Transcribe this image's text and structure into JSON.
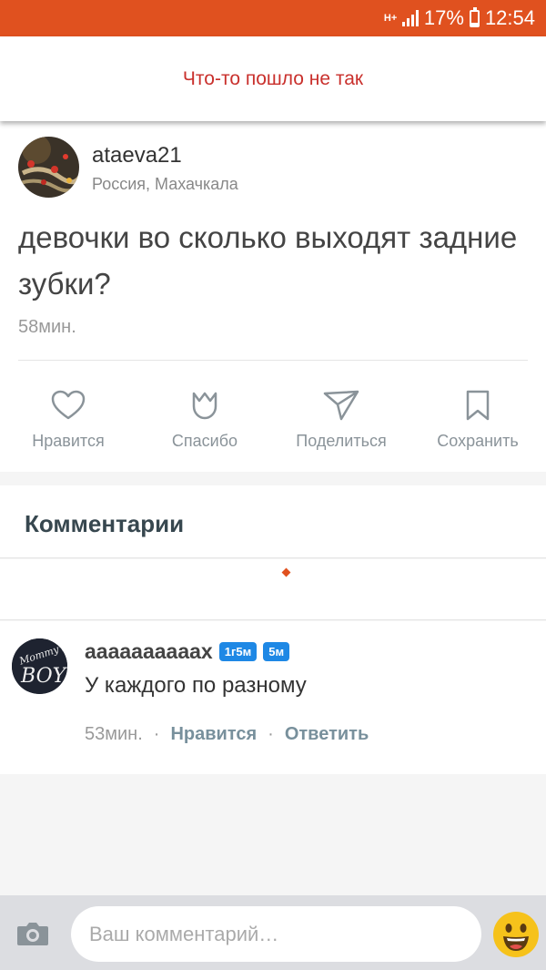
{
  "status_bar": {
    "network": "H+",
    "battery": "17%",
    "battery_level": 0.17,
    "time": "12:54",
    "accent": "#e0511f"
  },
  "error": {
    "message": "Что-то пошло не так",
    "color": "#c9302c"
  },
  "post": {
    "author": "ataeva21",
    "location": "Россия, Махачкала",
    "text": "девочки во сколько выходят задние зубки?",
    "time": "58мин.",
    "actions": [
      {
        "label": "Нравится",
        "icon": "heart-icon"
      },
      {
        "label": "Спасибо",
        "icon": "tulip-icon"
      },
      {
        "label": "Поделиться",
        "icon": "paper-plane-icon"
      },
      {
        "label": "Сохранить",
        "icon": "bookmark-icon"
      }
    ]
  },
  "comments": {
    "header": "Комментарии",
    "items": [
      {
        "author": "аааааааааах",
        "badges": [
          "1г5м",
          "5м"
        ],
        "avatar_text": "BOY",
        "text": "У каждого по разному",
        "time": "53мин.",
        "like": "Нравится",
        "reply": "Ответить"
      }
    ]
  },
  "composer": {
    "placeholder": "Ваш комментарий…",
    "camera_icon": "camera-icon",
    "emoji_icon": "smiley-icon"
  }
}
